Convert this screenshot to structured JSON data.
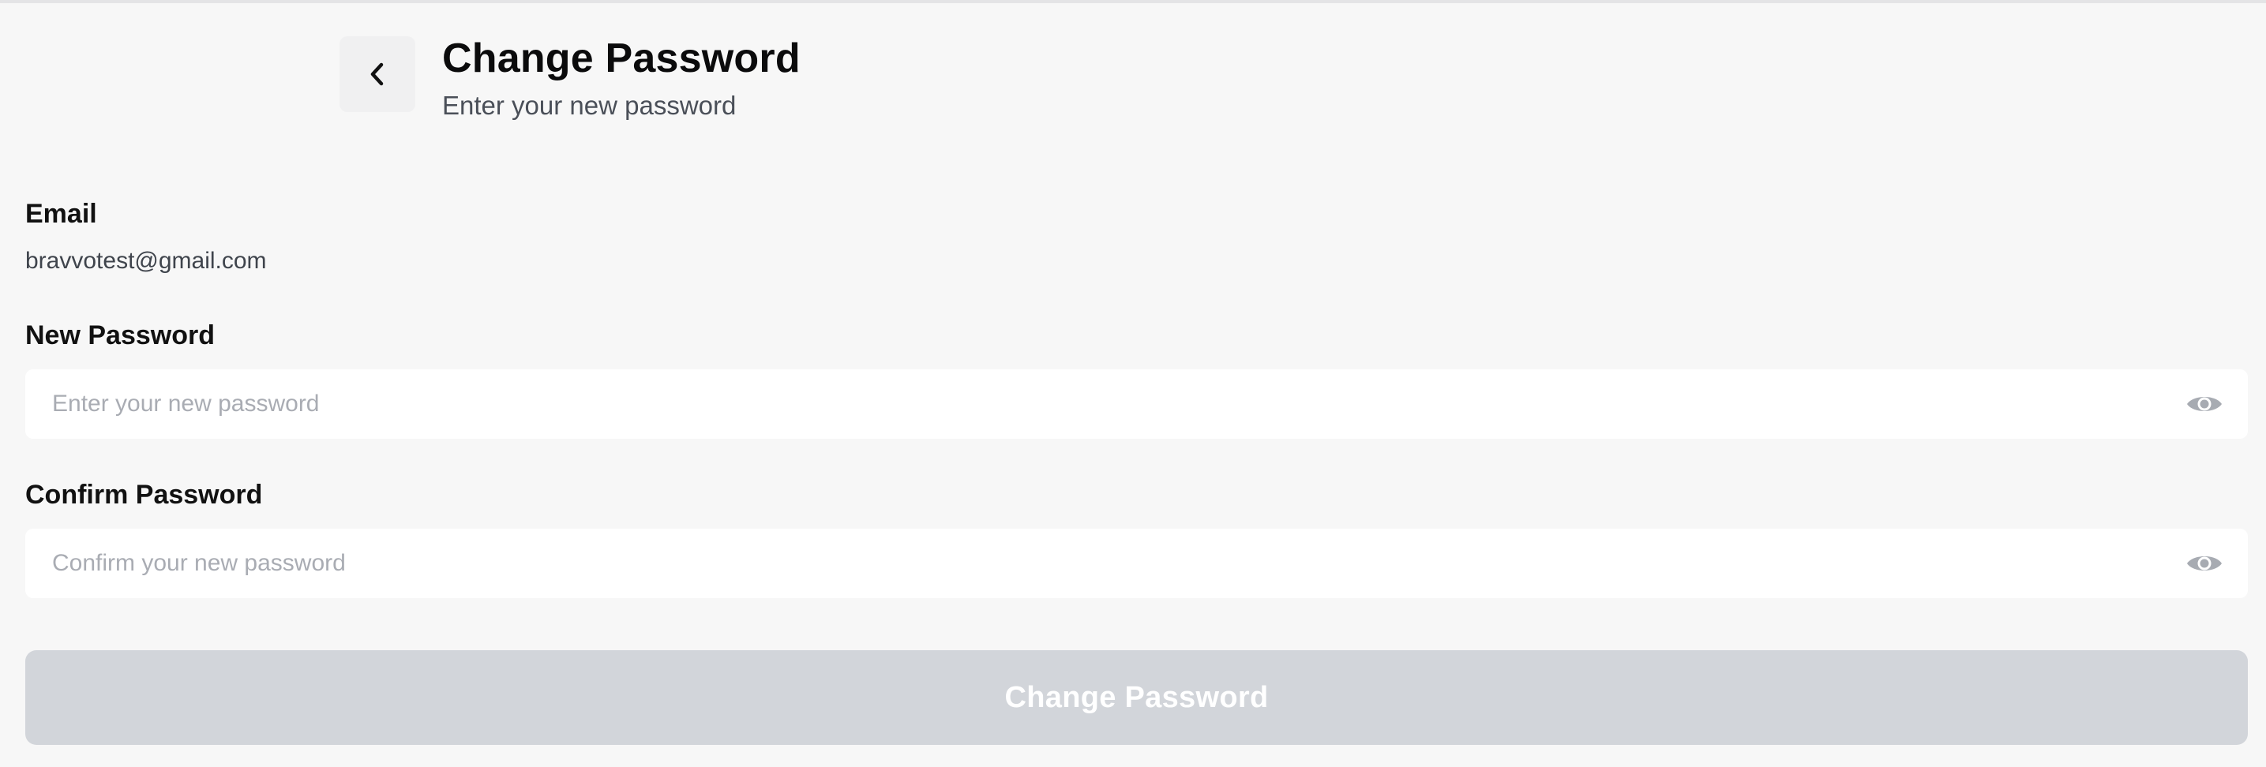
{
  "header": {
    "title": "Change Password",
    "subtitle": "Enter your new password"
  },
  "email": {
    "label": "Email",
    "value": "bravvotest@gmail.com"
  },
  "new_password": {
    "label": "New Password",
    "placeholder": "Enter your new password",
    "value": ""
  },
  "confirm_password": {
    "label": "Confirm Password",
    "placeholder": "Confirm your new password",
    "value": ""
  },
  "submit": {
    "label": "Change Password",
    "disabled": true
  },
  "icons": {
    "back": "chevron-left-icon",
    "visibility": "eye-icon"
  },
  "colors": {
    "background": "#f7f7f7",
    "input_background": "#ffffff",
    "button_disabled": "#d2d5da",
    "placeholder": "#a9acb3",
    "icon": "#a7abb2"
  }
}
